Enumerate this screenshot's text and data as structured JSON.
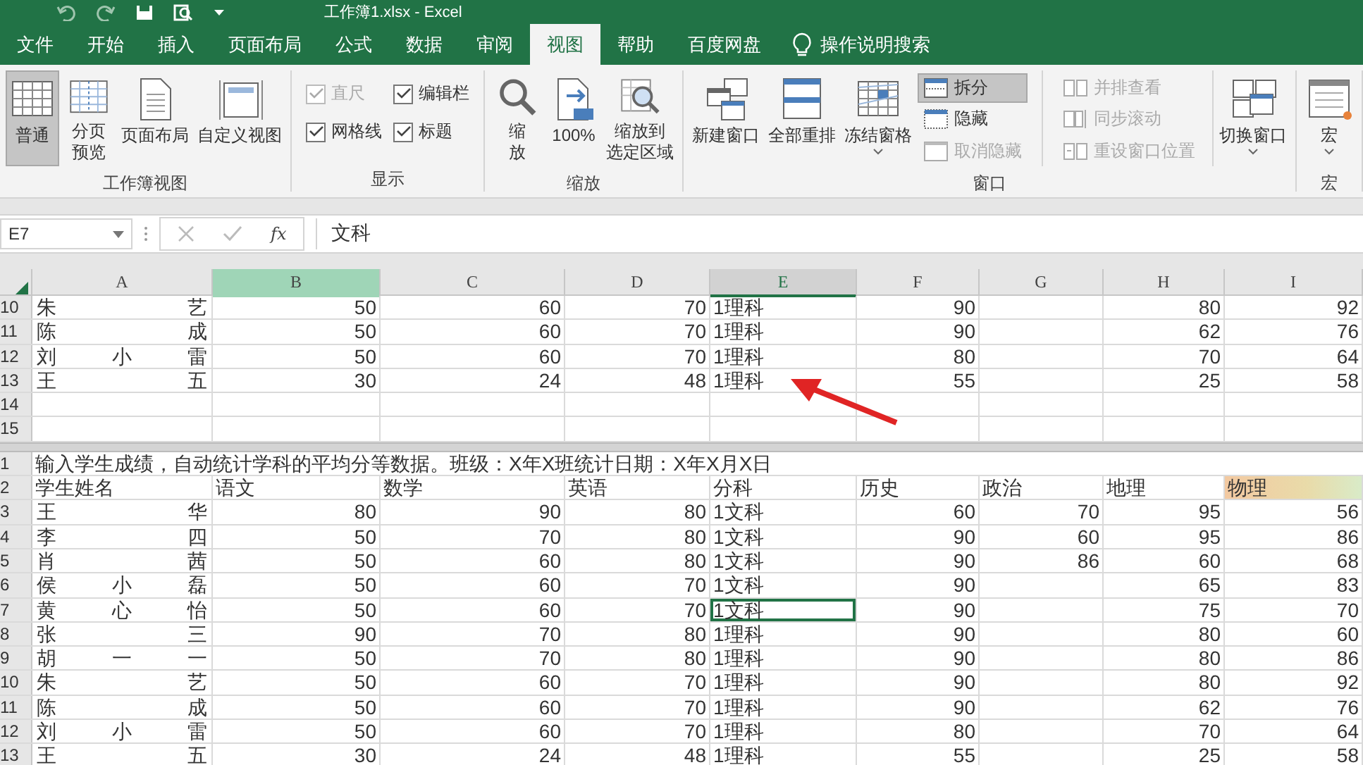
{
  "title_bar": {
    "title": "工作簿1.xlsx  -  Excel"
  },
  "tabs": [
    {
      "label": "文件",
      "selected": false
    },
    {
      "label": "开始",
      "selected": false
    },
    {
      "label": "插入",
      "selected": false
    },
    {
      "label": "页面布局",
      "selected": false
    },
    {
      "label": "公式",
      "selected": false
    },
    {
      "label": "数据",
      "selected": false
    },
    {
      "label": "审阅",
      "selected": false
    },
    {
      "label": "视图",
      "selected": true
    },
    {
      "label": "帮助",
      "selected": false
    },
    {
      "label": "百度网盘",
      "selected": false
    }
  ],
  "tell_me": {
    "placeholder": "操作说明搜索"
  },
  "ribbon": {
    "groups": [
      {
        "label": "工作簿视图",
        "items": [
          {
            "kind": "large",
            "label": "普通",
            "selected": true
          },
          {
            "kind": "large",
            "lines": [
              "分页",
              "预览"
            ],
            "selected": false
          },
          {
            "kind": "large",
            "label": "页面布局",
            "selected": false
          },
          {
            "kind": "large",
            "label": "自定义视图",
            "selected": false
          }
        ]
      },
      {
        "label": "显示",
        "items": [
          {
            "kind": "check",
            "label": "直尺",
            "checked": true,
            "disabled": true
          },
          {
            "kind": "check",
            "label": "编辑栏",
            "checked": true,
            "disabled": false
          },
          {
            "kind": "check",
            "label": "网格线",
            "checked": true,
            "disabled": false
          },
          {
            "kind": "check",
            "label": "标题",
            "checked": true,
            "disabled": false
          }
        ]
      },
      {
        "label": "缩放",
        "items": [
          {
            "kind": "large",
            "lines": [
              "缩",
              "放"
            ],
            "selected": false
          },
          {
            "kind": "large",
            "label": "100%",
            "selected": false
          },
          {
            "kind": "large",
            "lines": [
              "缩放到",
              "选定区域"
            ],
            "selected": false
          }
        ]
      },
      {
        "label": "窗口",
        "items": [
          {
            "kind": "large",
            "label": "新建窗口",
            "selected": false
          },
          {
            "kind": "large",
            "label": "全部重排",
            "selected": false
          },
          {
            "kind": "large",
            "label": "冻结窗格",
            "selected": false,
            "dropdown": true
          },
          {
            "kind": "small",
            "label": "拆分",
            "on": true,
            "disabled": false
          },
          {
            "kind": "small",
            "label": "隐藏",
            "on": false,
            "disabled": false
          },
          {
            "kind": "small",
            "label": "取消隐藏",
            "on": false,
            "disabled": true
          },
          {
            "kind": "small2",
            "label": "并排查看",
            "on": false,
            "disabled": true
          },
          {
            "kind": "small2",
            "label": "同步滚动",
            "on": false,
            "disabled": true
          },
          {
            "kind": "small2",
            "label": "重设窗口位置",
            "on": false,
            "disabled": true
          },
          {
            "kind": "large",
            "label": "切换窗口",
            "selected": false,
            "dropdown": true
          }
        ]
      },
      {
        "label": "宏",
        "items": [
          {
            "kind": "large",
            "label": "宏",
            "selected": false,
            "dropdown": true
          }
        ]
      }
    ]
  },
  "formula_bar": {
    "name_box": "E7",
    "fx": "fx",
    "value": "文科"
  },
  "columns": [
    {
      "label": "A",
      "selected": false,
      "highlighted": false
    },
    {
      "label": "B",
      "selected": false,
      "highlighted": true
    },
    {
      "label": "C",
      "selected": false,
      "highlighted": false
    },
    {
      "label": "D",
      "selected": false,
      "highlighted": false
    },
    {
      "label": "E",
      "selected": true,
      "highlighted": false
    },
    {
      "label": "F",
      "selected": false,
      "highlighted": false
    },
    {
      "label": "G",
      "selected": false,
      "highlighted": false
    },
    {
      "label": "H",
      "selected": false,
      "highlighted": false
    },
    {
      "label": "I",
      "selected": false,
      "highlighted": false
    }
  ],
  "top_pane": {
    "rows": [
      {
        "num": "10",
        "kind": "data",
        "cells": [
          "朱艺",
          "50",
          "60",
          "70",
          "1理科",
          "90",
          null,
          "80",
          "92"
        ]
      },
      {
        "num": "11",
        "kind": "data",
        "cells": [
          "陈成",
          "50",
          "60",
          "70",
          "1理科",
          "90",
          null,
          "62",
          "76"
        ]
      },
      {
        "num": "12",
        "kind": "data",
        "cells": [
          "刘小雷",
          "50",
          "60",
          "70",
          "1理科",
          "80",
          null,
          "70",
          "64"
        ]
      },
      {
        "num": "13",
        "kind": "data",
        "cells": [
          "王五",
          "30",
          "24",
          "48",
          "1理科",
          "55",
          null,
          "25",
          "58"
        ]
      },
      {
        "num": "14",
        "kind": "empty"
      },
      {
        "num": "15",
        "kind": "empty"
      }
    ]
  },
  "bottom_pane": {
    "rows": [
      {
        "num": "1",
        "kind": "title",
        "text": "输入学生成绩，自动统计学科的平均分等数据。班级：X年X班统计日期：X年X月X日"
      },
      {
        "num": "2",
        "kind": "header",
        "cells": [
          "学生姓名",
          "语文",
          "数学",
          "英语",
          "分科",
          "历史",
          "政治",
          "地理",
          {
            "text": "物理",
            "highlighted": true
          }
        ]
      },
      {
        "num": "3",
        "kind": "data",
        "cells": [
          "王华",
          "80",
          "90",
          "80",
          "1文科",
          "60",
          "70",
          "95",
          "56"
        ]
      },
      {
        "num": "4",
        "kind": "data",
        "cells": [
          "李四",
          "50",
          "70",
          "80",
          "1文科",
          "90",
          "60",
          "95",
          "86"
        ]
      },
      {
        "num": "5",
        "kind": "data",
        "cells": [
          "肖茜",
          "50",
          "60",
          "80",
          "1文科",
          "90",
          "86",
          "60",
          "68"
        ]
      },
      {
        "num": "6",
        "kind": "data",
        "cells": [
          "侯小磊",
          "50",
          "60",
          "70",
          "1文科",
          "90",
          null,
          "65",
          "83"
        ]
      },
      {
        "num": "7",
        "kind": "data",
        "cells": [
          "黄心怡",
          "50",
          "60",
          "70",
          {
            "text": "1文科",
            "selected": true
          },
          "90",
          null,
          "75",
          "70"
        ]
      },
      {
        "num": "8",
        "kind": "data",
        "cells": [
          "张三",
          "90",
          "70",
          "80",
          "1理科",
          "90",
          null,
          "80",
          "60"
        ]
      },
      {
        "num": "9",
        "kind": "data",
        "cells": [
          "胡一一",
          "50",
          "70",
          "80",
          "1理科",
          "90",
          null,
          "80",
          "86"
        ]
      },
      {
        "num": "10",
        "kind": "data",
        "cells": [
          "朱艺",
          "50",
          "60",
          "70",
          "1理科",
          "90",
          null,
          "80",
          "92"
        ]
      },
      {
        "num": "11",
        "kind": "data",
        "cells": [
          "陈成",
          "50",
          "60",
          "70",
          "1理科",
          "90",
          null,
          "62",
          "76"
        ]
      },
      {
        "num": "12",
        "kind": "data",
        "cells": [
          "刘小雷",
          "50",
          "60",
          "70",
          "1理科",
          "80",
          null,
          "70",
          "64"
        ]
      },
      {
        "num": "13",
        "kind": "data",
        "cells": [
          "王五",
          "30",
          "24",
          "48",
          "1理科",
          "55",
          null,
          "25",
          "58"
        ]
      }
    ]
  }
}
